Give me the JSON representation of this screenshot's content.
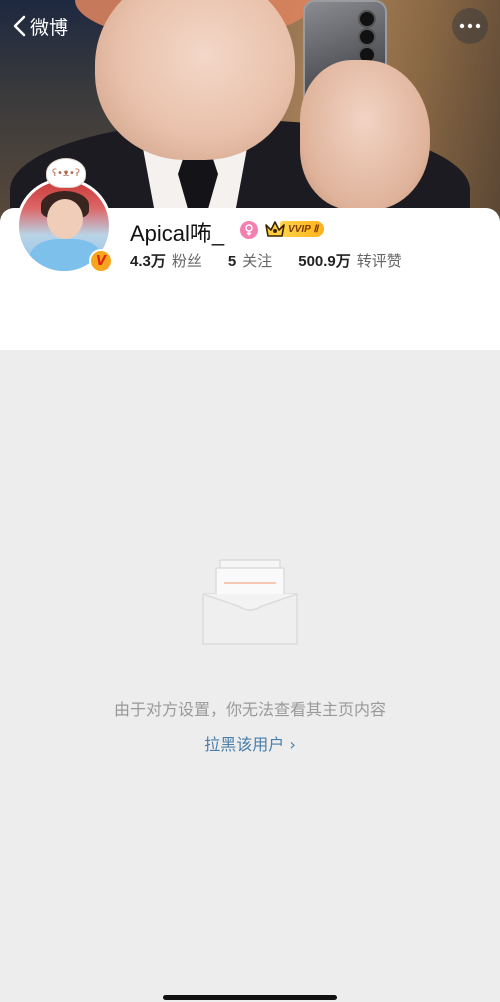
{
  "nav": {
    "back_label": "微博",
    "back_icon": "chevron-left-icon",
    "more_icon": "more-horizontal-icon"
  },
  "profile": {
    "username": "Apical咘_",
    "gender_icon": "female-icon",
    "vip_label": "VVIP Ⅱ",
    "verified_mark": "V",
    "stats": [
      {
        "value": "4.3万",
        "label": "粉丝"
      },
      {
        "value": "5",
        "label": "关注"
      },
      {
        "value": "500.9万",
        "label": "转评赞"
      }
    ]
  },
  "empty_state": {
    "icon": "empty-inbox-icon",
    "message": "由于对方设置，你无法查看其主页内容",
    "action_label": "拉黑该用户 ›"
  },
  "colors": {
    "background": "#ededed",
    "link": "#4a7ea8",
    "vip_gold": "#ffc42a",
    "gender_pink": "#f47fb0"
  }
}
